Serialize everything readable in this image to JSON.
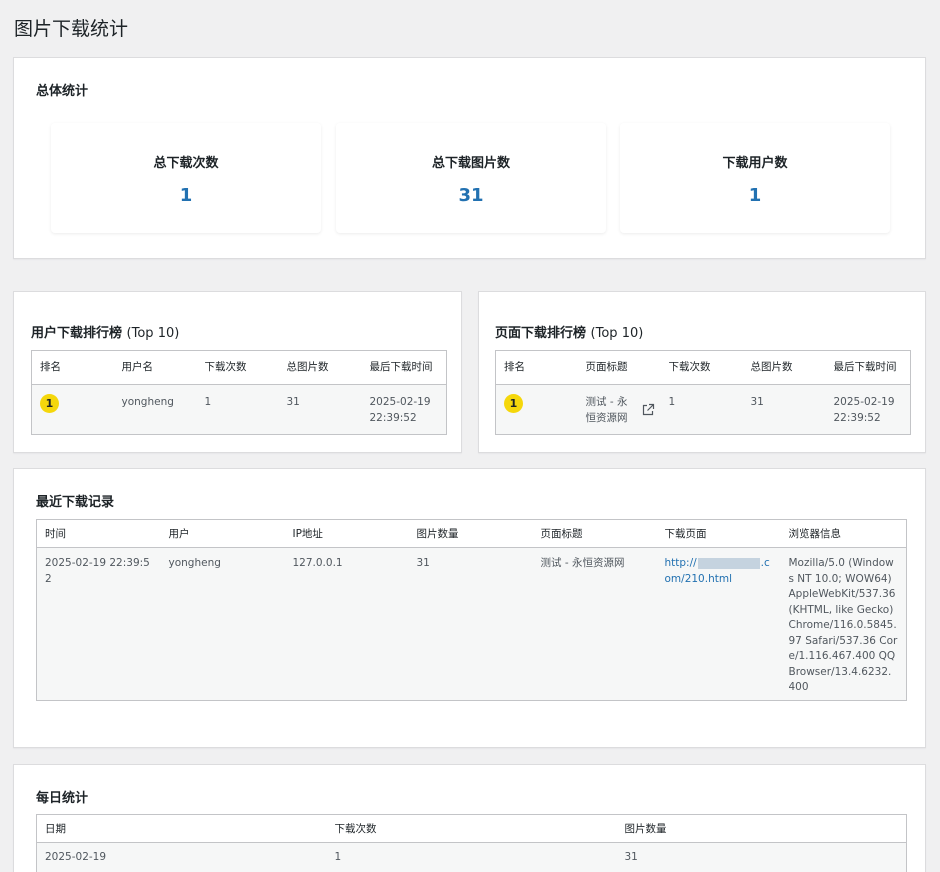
{
  "page": {
    "title": "图片下载统计"
  },
  "overall": {
    "title": "总体统计",
    "cards": [
      {
        "label": "总下载次数",
        "value": "1"
      },
      {
        "label": "总下载图片数",
        "value": "31"
      },
      {
        "label": "下载用户数",
        "value": "1"
      }
    ]
  },
  "user_rank": {
    "title": "用户下载排行榜",
    "title_suffix": "(Top 10)",
    "headers": [
      "排名",
      "用户名",
      "下载次数",
      "总图片数",
      "最后下载时间"
    ],
    "rows": [
      {
        "rank": "1",
        "user": "yongheng",
        "downloads": "1",
        "images": "31",
        "last_time": "2025-02-19 22:39:52"
      }
    ]
  },
  "page_rank": {
    "title": "页面下载排行榜",
    "title_suffix": "(Top 10)",
    "headers": [
      "排名",
      "页面标题",
      "下载次数",
      "总图片数",
      "最后下载时间"
    ],
    "rows": [
      {
        "rank": "1",
        "page_title": "测试 - 永恒资源网",
        "downloads": "1",
        "images": "31",
        "last_time": "2025-02-19 22:39:52"
      }
    ]
  },
  "recent": {
    "title": "最近下载记录",
    "headers": [
      "时间",
      "用户",
      "IP地址",
      "图片数量",
      "页面标题",
      "下载页面",
      "浏览器信息"
    ],
    "rows": [
      {
        "time": "2025-02-19 22:39:52",
        "user": "yongheng",
        "ip": "127.0.0.1",
        "images": "31",
        "page_title": "测试 - 永恒资源网",
        "url_prefix": "http://",
        "url_suffix": ".com/210.html",
        "browser": "Mozilla/5.0 (Windows NT 10.0; WOW64) AppleWebKit/537.36 (KHTML, like Gecko) Chrome/116.0.5845.97 Safari/537.36 Core/1.116.467.400 QQBrowser/13.4.6232.400"
      }
    ]
  },
  "daily": {
    "title": "每日统计",
    "headers": [
      "日期",
      "下载次数",
      "图片数量"
    ],
    "rows": [
      {
        "date": "2025-02-19",
        "downloads": "1",
        "images": "31"
      }
    ]
  },
  "colors": {
    "accent": "#2271b1",
    "badge": "#f5d70b",
    "background": "#f0f0f1"
  },
  "icons": {
    "external_link": "external-link-icon"
  }
}
